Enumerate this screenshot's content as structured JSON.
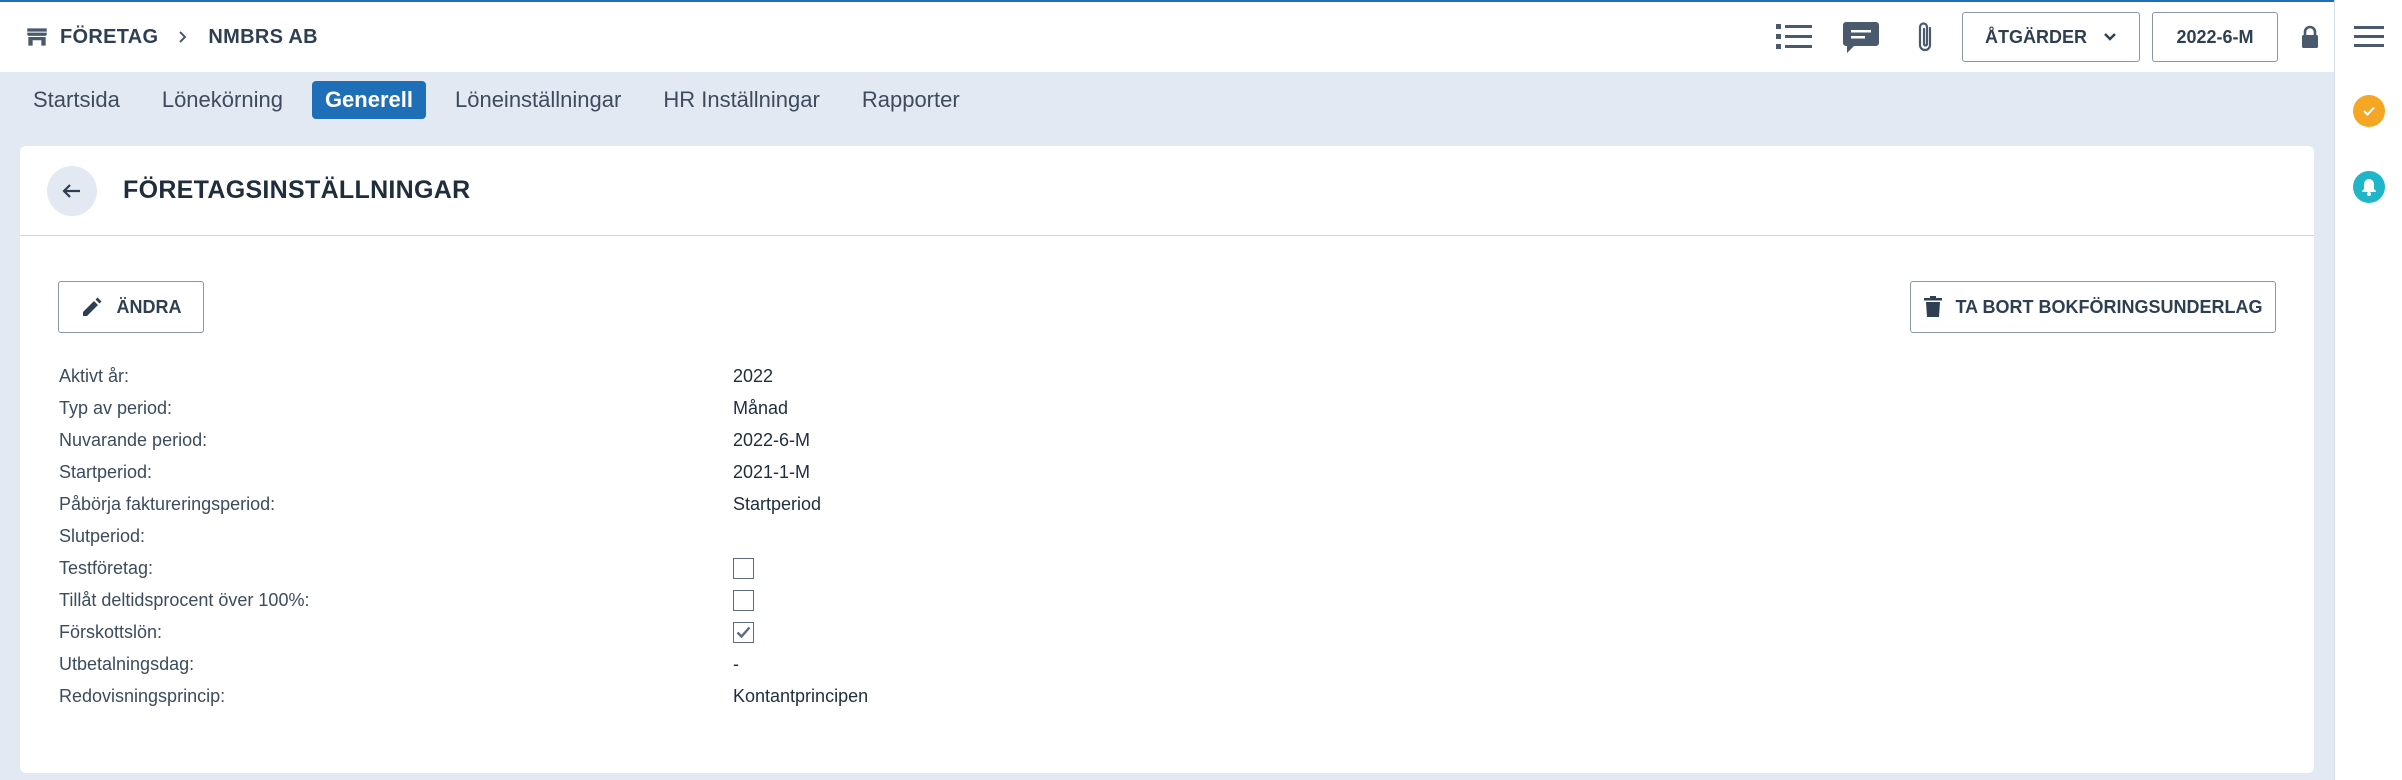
{
  "breadcrumb": {
    "section": "FÖRETAG",
    "company": "NMBRS AB"
  },
  "header": {
    "actions_label": "ÅTGÄRDER",
    "period_label": "2022-6-M"
  },
  "tabs": [
    {
      "label": "Startsida",
      "active": false
    },
    {
      "label": "Lönekörning",
      "active": false
    },
    {
      "label": "Generell",
      "active": true
    },
    {
      "label": "Löneinställningar",
      "active": false
    },
    {
      "label": "HR Inställningar",
      "active": false
    },
    {
      "label": "Rapporter",
      "active": false
    }
  ],
  "card": {
    "title": "FÖRETAGSINSTÄLLNINGAR",
    "edit_label": "ÄNDRA",
    "delete_label": "TA BORT BOKFÖRINGSUNDERLAG"
  },
  "fields": [
    {
      "label": "Aktivt år:",
      "value": "2022"
    },
    {
      "label": "Typ av period:",
      "value": "Månad"
    },
    {
      "label": "Nuvarande period:",
      "value": "2022-6-M"
    },
    {
      "label": "Startperiod:",
      "value": "2021-1-M"
    },
    {
      "label": "Påbörja faktureringsperiod:",
      "value": "Startperiod"
    },
    {
      "label": "Slutperiod:",
      "value": ""
    },
    {
      "label": "Testföretag:",
      "checked": false
    },
    {
      "label": "Tillåt deltidsprocent över 100%:",
      "checked": false
    },
    {
      "label": "Förskottslön:",
      "checked": true
    },
    {
      "label": "Utbetalningsdag:",
      "value": "-"
    },
    {
      "label": "Redovisningsprincip:",
      "value": "Kontantprincipen"
    }
  ],
  "colors": {
    "accent": "#1f6fb8",
    "page_bg": "#e2e9f2",
    "status_orange": "#f5a623",
    "status_teal": "#1fb6c9"
  },
  "icons": {
    "breadcrumb": "store-icon",
    "separator": "chevron-right-icon",
    "list": "list-icon",
    "chat": "chat-icon",
    "attach": "paperclip-icon",
    "lock": "lock-icon",
    "menu": "hamburger-menu-icon",
    "back": "arrow-left-icon",
    "edit": "pencil-icon",
    "delete": "trash-icon",
    "task": "check-circle-icon",
    "notify": "bell-icon"
  }
}
